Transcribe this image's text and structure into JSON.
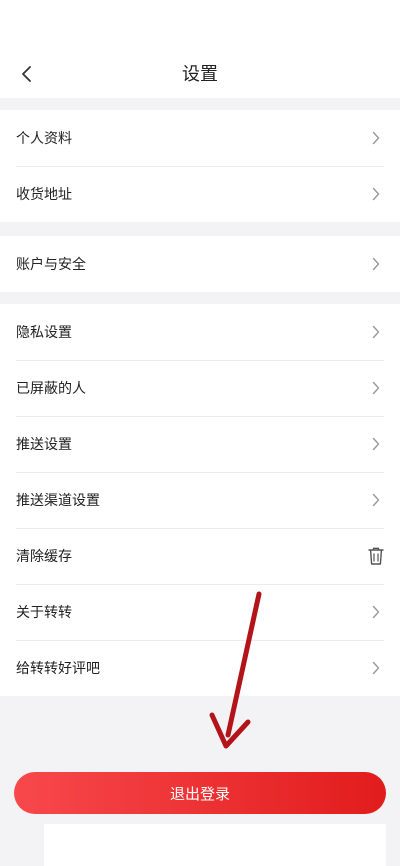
{
  "header": {
    "title": "设置",
    "back_icon": "chevron-left-icon"
  },
  "groups": [
    {
      "items": [
        {
          "label": "个人资料"
        },
        {
          "label": "收货地址"
        }
      ]
    },
    {
      "items": [
        {
          "label": "账户与安全"
        }
      ]
    },
    {
      "items": [
        {
          "label": "隐私设置"
        },
        {
          "label": "已屏蔽的人"
        },
        {
          "label": "推送设置"
        },
        {
          "label": "推送渠道设置"
        },
        {
          "label": "清除缓存",
          "icon": "trash-icon"
        },
        {
          "label": "关于转转"
        },
        {
          "label": "给转转好评吧"
        }
      ]
    }
  ],
  "logout": {
    "label": "退出登录"
  },
  "colors": {
    "accent": "#e9262a",
    "annotation_arrow": "#b3141a",
    "background": "#f3f3f5"
  }
}
